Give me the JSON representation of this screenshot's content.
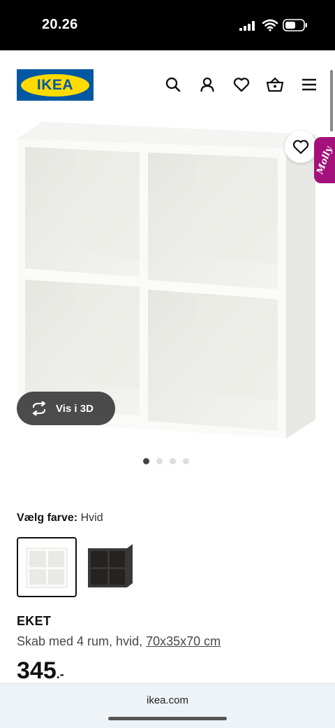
{
  "status_bar": {
    "time": "20.26"
  },
  "header": {
    "logo_text": "IKEA",
    "icons": [
      "search-icon",
      "user-icon",
      "heart-icon",
      "basket-icon",
      "menu-icon"
    ]
  },
  "gallery": {
    "vis3d_label": "Vis i 3D",
    "assistant_label": "Molly",
    "dot_count": 4,
    "active_dot": 1
  },
  "color_picker": {
    "label": "Vælg farve:",
    "value": "Hvid",
    "options": [
      "Hvid",
      "Mørkegrå"
    ]
  },
  "product": {
    "name": "EKET",
    "description": "Skab med 4 rum, hvid, ",
    "dimensions": "70x35x70 cm",
    "price": "345",
    "price_suffix": ".-"
  },
  "browser": {
    "url": "ikea.com"
  },
  "colors": {
    "ikea_blue": "#0058a3",
    "ikea_yellow": "#ffdb00",
    "molly_magenta": "#a4117a"
  }
}
